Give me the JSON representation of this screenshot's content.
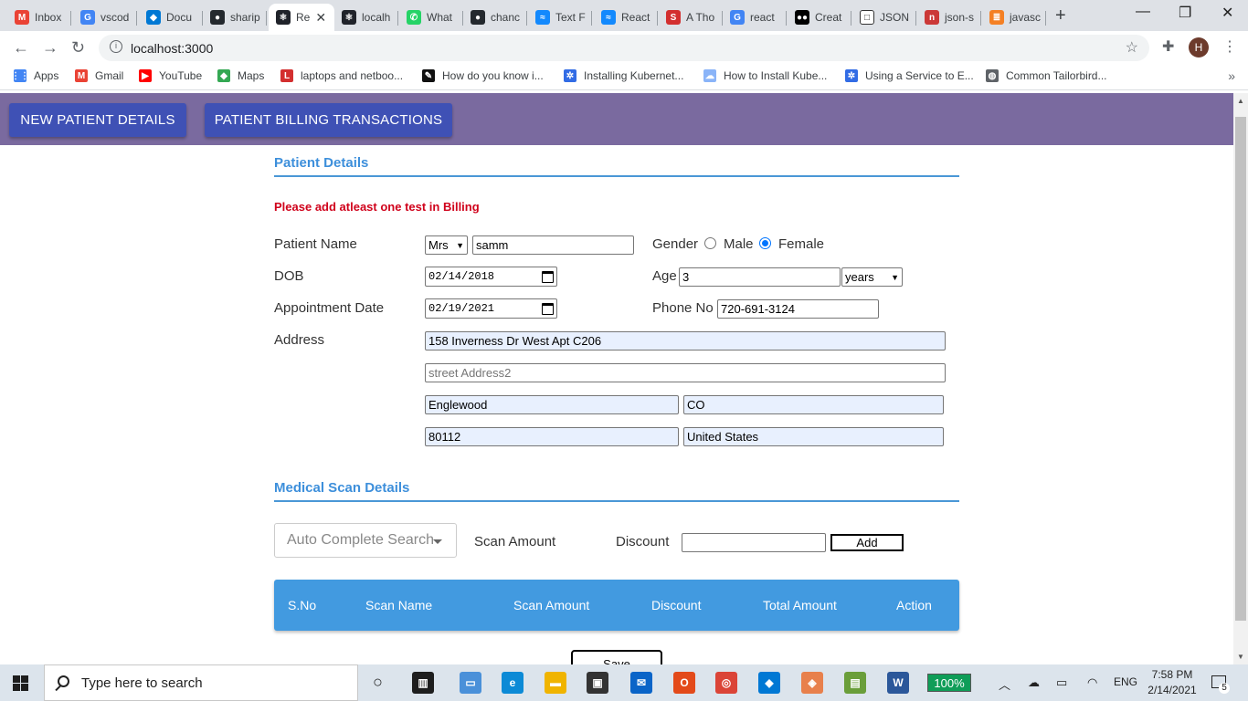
{
  "browser": {
    "tabs": [
      {
        "title": "Inbox",
        "icon": "gmail-icon",
        "color": "#ea4335",
        "glyph": "M"
      },
      {
        "title": "vscod",
        "icon": "google-icon",
        "color": "#4285f4",
        "glyph": "G"
      },
      {
        "title": "Docu",
        "icon": "vscode-icon",
        "color": "#0078d4",
        "glyph": "◆"
      },
      {
        "title": "sharip",
        "icon": "github-icon",
        "color": "#24292e",
        "glyph": "●"
      },
      {
        "title": "Re",
        "icon": "react-icon",
        "color": "#20232a",
        "glyph": "⚛",
        "active": true
      },
      {
        "title": "localh",
        "icon": "react-icon",
        "color": "#20232a",
        "glyph": "⚛"
      },
      {
        "title": "What",
        "icon": "whatsapp-icon",
        "color": "#25d366",
        "glyph": "✆"
      },
      {
        "title": "chanc",
        "icon": "github-icon",
        "color": "#24292e",
        "glyph": "●"
      },
      {
        "title": "Text F",
        "icon": "stackblitz-icon",
        "color": "#1389fd",
        "glyph": "≈"
      },
      {
        "title": "React",
        "icon": "stackblitz-icon",
        "color": "#1389fd",
        "glyph": "≈"
      },
      {
        "title": "A Tho",
        "icon": "scribd-icon",
        "color": "#d32f2f",
        "glyph": "S"
      },
      {
        "title": "react",
        "icon": "google-icon",
        "color": "#4285f4",
        "glyph": "G"
      },
      {
        "title": "Creat",
        "icon": "medium-icon",
        "color": "#000000",
        "glyph": "●●"
      },
      {
        "title": "JSON",
        "icon": "page-icon",
        "color": "#ffffff",
        "glyph": "□"
      },
      {
        "title": "json-s",
        "icon": "npm-icon",
        "color": "#cb3837",
        "glyph": "n"
      },
      {
        "title": "javasc",
        "icon": "stackoverflow-icon",
        "color": "#f48024",
        "glyph": "≣"
      }
    ],
    "new_tab": "+",
    "window_controls": {
      "minimize": "—",
      "maximize": "❐",
      "close": "✕"
    },
    "url": "localhost:3000",
    "avatar_letter": "H",
    "bookmarks": [
      {
        "label": "Apps",
        "icon": "apps-grid-icon",
        "color": "#4285f4",
        "glyph": "⋮⋮"
      },
      {
        "label": "Gmail",
        "icon": "gmail-icon",
        "color": "#ea4335",
        "glyph": "M"
      },
      {
        "label": "YouTube",
        "icon": "youtube-icon",
        "color": "#ff0000",
        "glyph": "▶"
      },
      {
        "label": "Maps",
        "icon": "maps-icon",
        "color": "#34a853",
        "glyph": "◆"
      },
      {
        "label": "laptops and netboo...",
        "icon": "l-icon",
        "color": "#d32f2f",
        "glyph": "L"
      },
      {
        "label": "How do you know i...",
        "icon": "feather-icon",
        "color": "#111111",
        "glyph": "✎"
      },
      {
        "label": "Installing Kubernet...",
        "icon": "kubernetes-icon",
        "color": "#326ce5",
        "glyph": "✲"
      },
      {
        "label": "How to Install Kube...",
        "icon": "cloud-icon",
        "color": "#8ab4f8",
        "glyph": "☁"
      },
      {
        "label": "Using a Service to E...",
        "icon": "kubernetes-icon",
        "color": "#326ce5",
        "glyph": "✲"
      },
      {
        "label": "Common Tailorbird...",
        "icon": "globe-icon",
        "color": "#5f6368",
        "glyph": "◍"
      }
    ],
    "bookmarks_more": "»"
  },
  "app": {
    "nav": {
      "new_patient": "NEW PATIENT DETAILS",
      "billing": "PATIENT BILLING TRANSACTIONS"
    },
    "patient_section_title": "Patient Details",
    "error_message": "Please add atleast one test in Billing",
    "labels": {
      "patient_name": "Patient Name",
      "dob": "DOB",
      "appointment_date": "Appointment Date",
      "address": "Address",
      "gender": "Gender",
      "male": "Male",
      "female": "Female",
      "age": "Age",
      "phone": "Phone No"
    },
    "values": {
      "title": "Mrs",
      "name": "samm",
      "dob": "02/14/2018",
      "appointment_date": "02/19/2021",
      "age": "3",
      "age_unit": "years",
      "phone": "720-691-3124",
      "address1": "158 Inverness Dr West Apt C206",
      "city": "Englewood",
      "state": "CO",
      "zip": "80112",
      "country": "United States",
      "gender": "Female"
    },
    "placeholders": {
      "address2": "street Address2"
    },
    "scan_section_title": "Medical Scan Details",
    "scan_form": {
      "autocomplete_placeholder": "Auto Complete Search",
      "scan_amount_label": "Scan Amount",
      "discount_label": "Discount",
      "add_label": "Add"
    },
    "table_headers": [
      "S.No",
      "Scan Name",
      "Scan Amount",
      "Discount",
      "Total Amount",
      "Action"
    ],
    "save_label": "Save",
    "colors": {
      "appbar": "#7a6a9f",
      "nav_button": "#3f51b5",
      "section_title": "#3d8fdb",
      "table_header": "#429ae0",
      "error": "#d0021b"
    }
  },
  "taskbar": {
    "search_placeholder": "Type here to search",
    "battery": "100%",
    "language": "ENG",
    "time": "7:58 PM",
    "date": "2/14/2021",
    "notification_count": "5",
    "pinned": [
      {
        "icon": "task-view-icon",
        "color": "#1e1e1e",
        "glyph": "▥"
      },
      {
        "icon": "remote-desktop-icon",
        "color": "#4a90d9",
        "glyph": "▭"
      },
      {
        "icon": "edge-icon",
        "color": "#0c8ad6",
        "glyph": "e"
      },
      {
        "icon": "file-explorer-icon",
        "color": "#f0b400",
        "glyph": "▬"
      },
      {
        "icon": "store-icon",
        "color": "#333333",
        "glyph": "▣"
      },
      {
        "icon": "mail-icon",
        "color": "#0a64c8",
        "glyph": "✉"
      },
      {
        "icon": "office-icon",
        "color": "#e34a1a",
        "glyph": "O"
      },
      {
        "icon": "chrome-icon",
        "color": "#db4437",
        "glyph": "◎"
      },
      {
        "icon": "vscode-icon",
        "color": "#0078d4",
        "glyph": "◆"
      },
      {
        "icon": "sourcetree-icon",
        "color": "#e8804c",
        "glyph": "◈"
      },
      {
        "icon": "charts-app-icon",
        "color": "#6a9e3a",
        "glyph": "▤"
      },
      {
        "icon": "word-icon",
        "color": "#2b579a",
        "glyph": "W"
      }
    ]
  }
}
